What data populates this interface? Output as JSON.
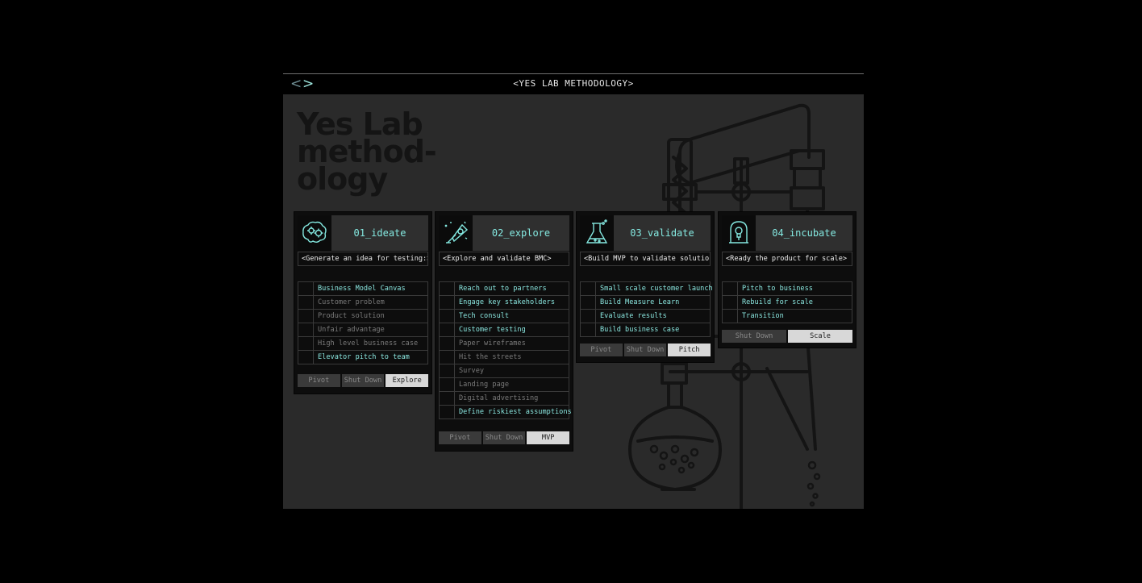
{
  "window": {
    "title": "<YES LAB METHODOLOGY>",
    "nav_prev": "<",
    "nav_next": ">"
  },
  "heading": {
    "lines": [
      "Yes Lab",
      "method-",
      "ology"
    ]
  },
  "colors": {
    "accent": "#84e8e0",
    "background": "#2a2a2a",
    "card": "#0d0d0d",
    "primary_button": "#d8d8d8"
  },
  "stages": [
    {
      "title": "01_ideate",
      "icon": "brain-gears-icon",
      "subtitle": "<Generate an idea for testing:>",
      "tasks": [
        {
          "label": "Business Model Canvas",
          "active": true
        },
        {
          "label": "Customer problem",
          "active": false
        },
        {
          "label": "Product solution",
          "active": false
        },
        {
          "label": "Unfair advantage",
          "active": false
        },
        {
          "label": "High level business case",
          "active": false
        },
        {
          "label": "Elevator pitch to team",
          "active": true
        }
      ],
      "actions": [
        {
          "label": "Pivot",
          "primary": false
        },
        {
          "label": "Shut Down",
          "primary": false
        },
        {
          "label": "Explore",
          "primary": true
        }
      ]
    },
    {
      "title": "02_explore",
      "icon": "telescope-icon",
      "subtitle": "<Explore and validate BMC>",
      "tasks": [
        {
          "label": "Reach out to partners",
          "active": true
        },
        {
          "label": "Engage key stakeholders",
          "active": true
        },
        {
          "label": "Tech consult",
          "active": true
        },
        {
          "label": "Customer testing",
          "active": true
        },
        {
          "label": "Paper wireframes",
          "active": false
        },
        {
          "label": "Hit the streets",
          "active": false
        },
        {
          "label": "Survey",
          "active": false
        },
        {
          "label": "Landing page",
          "active": false
        },
        {
          "label": "Digital advertising",
          "active": false
        },
        {
          "label": "Define riskiest assumptions",
          "active": true
        }
      ],
      "actions": [
        {
          "label": "Pivot",
          "primary": false
        },
        {
          "label": "Shut Down",
          "primary": false
        },
        {
          "label": "MVP",
          "primary": true
        }
      ]
    },
    {
      "title": "03_validate",
      "icon": "flask-icon",
      "subtitle": "<Build MVP to validate solution>",
      "tasks": [
        {
          "label": "Small scale customer launch",
          "active": true
        },
        {
          "label": "Build Measure Learn",
          "active": true
        },
        {
          "label": "Evaluate results",
          "active": true
        },
        {
          "label": "Build business case",
          "active": true
        }
      ],
      "actions": [
        {
          "label": "Pivot",
          "primary": false
        },
        {
          "label": "Shut Down",
          "primary": false
        },
        {
          "label": "Pitch",
          "primary": true
        }
      ]
    },
    {
      "title": "04_incubate",
      "icon": "bell-jar-bulb-icon",
      "subtitle": "<Ready the product for scale>",
      "tasks": [
        {
          "label": "Pitch to business",
          "active": true
        },
        {
          "label": "Rebuild for scale",
          "active": true
        },
        {
          "label": "Transition",
          "active": true
        }
      ],
      "actions": [
        {
          "label": "Shut Down",
          "primary": false
        },
        {
          "label": "Scale",
          "primary": true
        }
      ]
    }
  ]
}
